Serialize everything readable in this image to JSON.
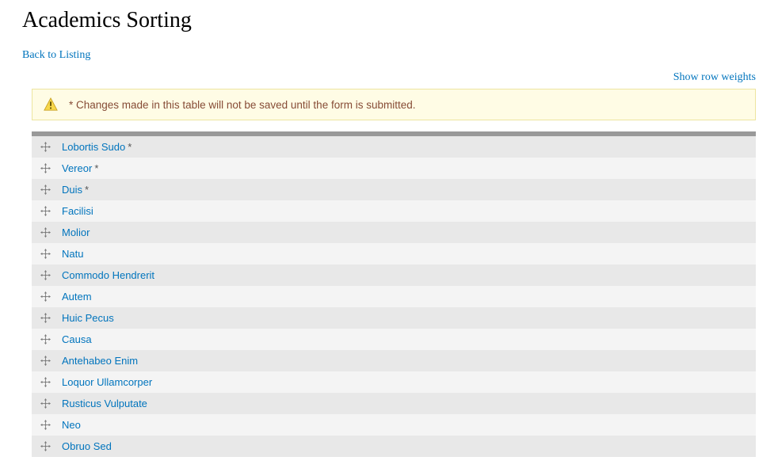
{
  "page": {
    "title": "Academics Sorting",
    "back_link": "Back to Listing",
    "show_weights": "Show row weights",
    "warning": "* Changes made in this table will not be saved until the form is submitted."
  },
  "rows": [
    {
      "label": "Lobortis Sudo",
      "changed": true
    },
    {
      "label": "Vereor",
      "changed": true
    },
    {
      "label": "Duis",
      "changed": true
    },
    {
      "label": "Facilisi",
      "changed": false
    },
    {
      "label": "Molior",
      "changed": false
    },
    {
      "label": "Natu",
      "changed": false
    },
    {
      "label": "Commodo Hendrerit",
      "changed": false
    },
    {
      "label": "Autem",
      "changed": false
    },
    {
      "label": "Huic Pecus",
      "changed": false
    },
    {
      "label": "Causa",
      "changed": false
    },
    {
      "label": "Antehabeo Enim",
      "changed": false
    },
    {
      "label": "Loquor Ullamcorper",
      "changed": false
    },
    {
      "label": "Rusticus Vulputate",
      "changed": false
    },
    {
      "label": "Neo",
      "changed": false
    },
    {
      "label": "Obruo Sed",
      "changed": false
    }
  ]
}
